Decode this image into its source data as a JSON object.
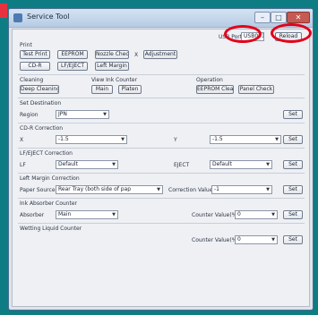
{
  "window": {
    "title": "Service Tool"
  },
  "usb_port": {
    "label": "USB Port",
    "value": "USB001",
    "reload_label": "Reload"
  },
  "print": {
    "label": "Print",
    "buttons": [
      "Test Print",
      "EEPROM",
      "Nozzle Check",
      "Adjustment",
      "CD-R",
      "LF/EJECT",
      "Left Margin"
    ],
    "x_label": "X"
  },
  "cleaning": {
    "label": "Cleaning",
    "button": "Deep Cleaning"
  },
  "view_ink_counter": {
    "label": "View Ink Counter",
    "buttons": [
      "Main",
      "Platen"
    ]
  },
  "operation": {
    "label": "Operation",
    "buttons": [
      "EEPROM Clear",
      "Panel Check"
    ]
  },
  "set_destination": {
    "label": "Set Destination",
    "field_label": "Region",
    "value": "JPN",
    "set_label": "Set"
  },
  "cdr_correction": {
    "label": "CD-R Correction",
    "x_label": "X",
    "x_value": "-1.5",
    "y_label": "Y",
    "y_value": "-1.5",
    "set_label": "Set"
  },
  "lf_eject_correction": {
    "label": "LF/EJECT Correction",
    "lf_label": "LF",
    "lf_value": "Default",
    "eject_label": "EJECT",
    "eject_value": "Default",
    "set_label": "Set"
  },
  "left_margin_correction": {
    "label": "Left Margin Correction",
    "paper_source_label": "Paper Source",
    "paper_source_value": "Rear Tray (both side of pap",
    "correction_label": "Correction Value",
    "correction_value": "-1",
    "set_label": "Set"
  },
  "ink_absorber_counter": {
    "label": "Ink Absorber Counter",
    "absorber_label": "Absorber",
    "absorber_value": "Main",
    "counter_label": "Counter Value(%)",
    "counter_value": "0",
    "set_label": "Set"
  },
  "wetting_liquid_counter": {
    "label": "Wetting Liquid Counter",
    "counter_label": "Counter Value(%)",
    "counter_value": "0",
    "set_label": "Set"
  },
  "colors": {
    "highlight": "#e2001a",
    "background": "#0e7c83"
  }
}
